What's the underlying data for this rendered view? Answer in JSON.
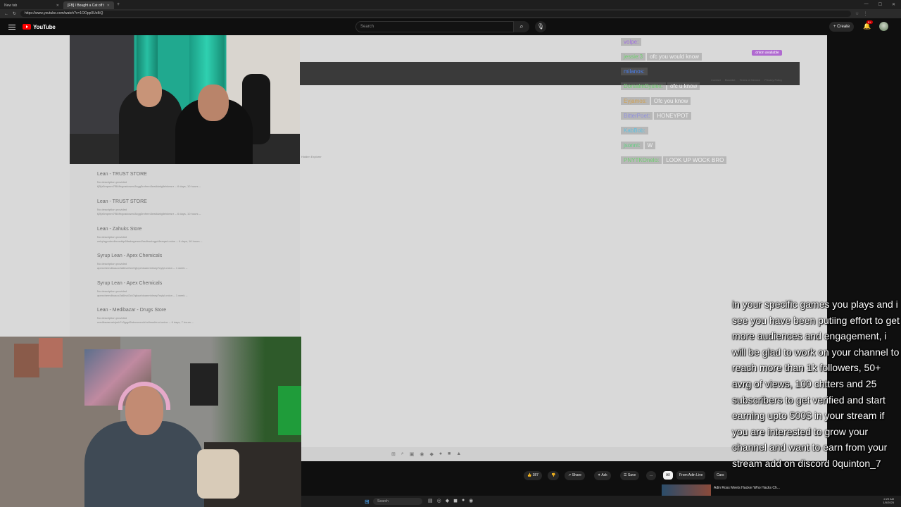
{
  "browser": {
    "tabs": [
      {
        "label": "New tab"
      },
      {
        "label": "[FB] I Bought a Cat off the D..."
      }
    ],
    "url": "https://www.youtube.com/watch?v=1OOpp0Ue8iQ"
  },
  "youtube": {
    "logo_text": "YouTube",
    "search_placeholder": "Search",
    "create_label": "Create",
    "notification_count": "9+"
  },
  "listings": [
    {
      "title": "Lean - TRUST STORE",
      "desc": "No description provided",
      "url": "tj2fjz5mpmm7f54ffxgvadowzw3zgg3rnfrmn3ewiklwlgllehkmsrr -- 6 days, 10 hours --"
    },
    {
      "title": "Lean - TRUST STORE",
      "desc": "No description provided",
      "url": "tj2fjz5mpmm7f54ffxgvadowzw3zgg3rnfrmn3ewiklwlgllehkmsrr -- 6 days, 10 hours --"
    },
    {
      "title": "Lean - Zahuks Store",
      "desc": "No description provided",
      "url": "zebyhgyvdmdbcxwbtp6ftadwgzwao2ss4twnbqgvl4eaqad.onion -- 6 days, 16 hours --"
    },
    {
      "title": "Syrup Lean - Apex Chemicals",
      "desc": "No description provided",
      "url": "apexchemdbuaoc2a6kvd2ck7qfpyxhiuanmhiewy7nylyl.onion -- 1 week --"
    },
    {
      "title": "Syrup Lean - Apex Chemicals",
      "desc": "No description provided",
      "url": "apexchemdbuaoc2a6kvd2ck7qfpyxhiuanmhiewy7nylyl.onion -- 1 week --"
    },
    {
      "title": "Lean - Medibazar - Drugs Store",
      "desc": "No description provided",
      "url": "medibazarueivjmk7x3gqpf5uknxmen4rhcfinnshlrzd.onion -- 6 days, 7 hours --"
    }
  ],
  "site": {
    "onion_badge": ".onion available",
    "links": [
      "Contact",
      "Blacklist",
      "Terms of Service",
      "Privacy Policy"
    ],
    "side_label": "Hidden Explorer"
  },
  "chat": [
    {
      "name": "volpe:",
      "msg": "",
      "color": "#a070e0"
    },
    {
      "name": "jessie:3",
      "msg": "ofc you would know",
      "color": "#6fd06f"
    },
    {
      "name": "milanos:",
      "msg": "",
      "color": "#4a7ff0"
    },
    {
      "name": "DorsalmDyslex:",
      "msg": "ofc u know",
      "color": "#6fd06f"
    },
    {
      "name": "Eyjamos:",
      "msg": "Ofc you know",
      "color": "#d0a050"
    },
    {
      "name": "BitterPoet:",
      "msg": "HONEYPOT",
      "color": "#9090e0"
    },
    {
      "name": "KabBob:",
      "msg": "",
      "color": "#60c0e0"
    },
    {
      "name": "jsonnt:",
      "msg": "W",
      "color": "#60d080"
    },
    {
      "name": "PNYTKOnelo:",
      "msg": "LOOK UP WOCK BRO",
      "color": "#6fd06f"
    }
  ],
  "actions": {
    "likes": "387",
    "share": "Share",
    "ask": "Ask",
    "save": "Save",
    "more": "...",
    "chips": [
      "All",
      "From Adin Live",
      "Cars"
    ]
  },
  "taskbar": {
    "search": "Search",
    "time": "2:29 AM",
    "date": "1/5/2025"
  },
  "overlay_text": "in your specific games you plays and i see you have been putiing effort to get more audiences and engagement, i will be glad to work on your channel to reach more than 1k followers, 50+ avrg of views, 100 chtters and 25 subscribers to get verified and start earning upto 500$ in your stream if you are interested to grow your channel and want to earn from your stream add on discord 0quinton_7",
  "up_next": {
    "title": "Adin Ross Meets Hacker Who Hacks Ch..."
  }
}
